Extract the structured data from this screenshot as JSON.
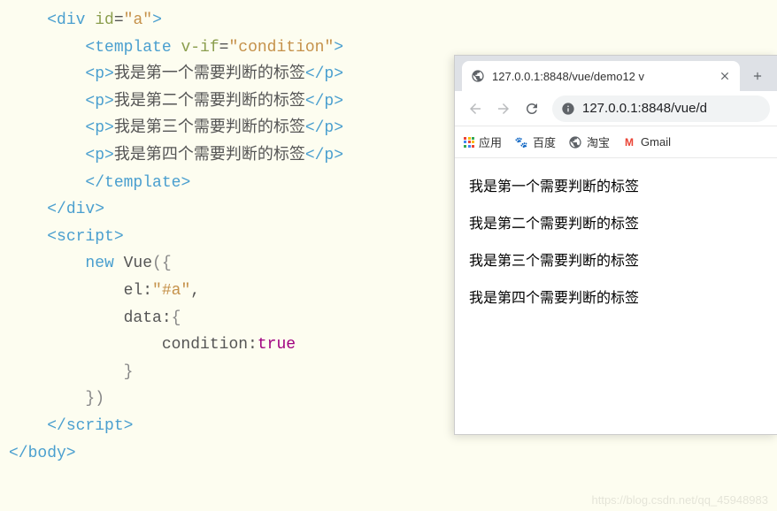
{
  "code": {
    "l1": {
      "indent": "    ",
      "tag1": "<div",
      "attr": " id",
      "eq": "=",
      "val": "\"a\"",
      "close": ">"
    },
    "l2": {
      "indent": "        ",
      "tag1": "<template",
      "attr": " v-if",
      "eq": "=",
      "val": "\"condition\"",
      "close": ">"
    },
    "l3": {
      "indent": "        ",
      "tag1": "<p>",
      "text": "我是第一个需要判断的标签",
      "tag2": "</p>"
    },
    "l4": {
      "indent": "        ",
      "tag1": "<p>",
      "text": "我是第二个需要判断的标签",
      "tag2": "</p>"
    },
    "l5": {
      "indent": "        ",
      "tag1": "<p>",
      "text": "我是第三个需要判断的标签",
      "tag2": "</p>"
    },
    "l6": {
      "indent": "        ",
      "tag1": "<p>",
      "text": "我是第四个需要判断的标签",
      "tag2": "</p>"
    },
    "l7": {
      "indent": "        ",
      "tag1": "</template>"
    },
    "l8": {
      "indent": "    ",
      "tag1": "</div>"
    },
    "l9": {
      "indent": ""
    },
    "l10": {
      "indent": "    ",
      "tag1": "<script>"
    },
    "l11": {
      "indent": "        ",
      "kw": "new",
      "obj": " Vue",
      "paren": "({"
    },
    "l12": {
      "indent": "            ",
      "prop": "el",
      "colon": ":",
      "val": "\"#a\"",
      "comma": ","
    },
    "l13": {
      "indent": "            ",
      "prop": "data",
      "colon": ":",
      "brace": "{"
    },
    "l14": {
      "indent": "                ",
      "prop": "condition",
      "colon": ":",
      "bool": "true"
    },
    "l15": {
      "indent": "            ",
      "brace": "}"
    },
    "l16": {
      "indent": "        ",
      "close": "})"
    },
    "l17": {
      "indent": "    ",
      "tag1": "</script>"
    },
    "l18": {
      "indent": "",
      "tag1": "</body>"
    }
  },
  "browser": {
    "tab_title": "127.0.0.1:8848/vue/demo12 v",
    "url": "127.0.0.1:8848/vue/d",
    "bookmarks": {
      "apps": "应用",
      "baidu": "百度",
      "taobao": "淘宝",
      "gmail": "Gmail"
    },
    "content": {
      "p1": "我是第一个需要判断的标签",
      "p2": "我是第二个需要判断的标签",
      "p3": "我是第三个需要判断的标签",
      "p4": "我是第四个需要判断的标签"
    }
  },
  "watermark": "https://blog.csdn.net/qq_45948983"
}
